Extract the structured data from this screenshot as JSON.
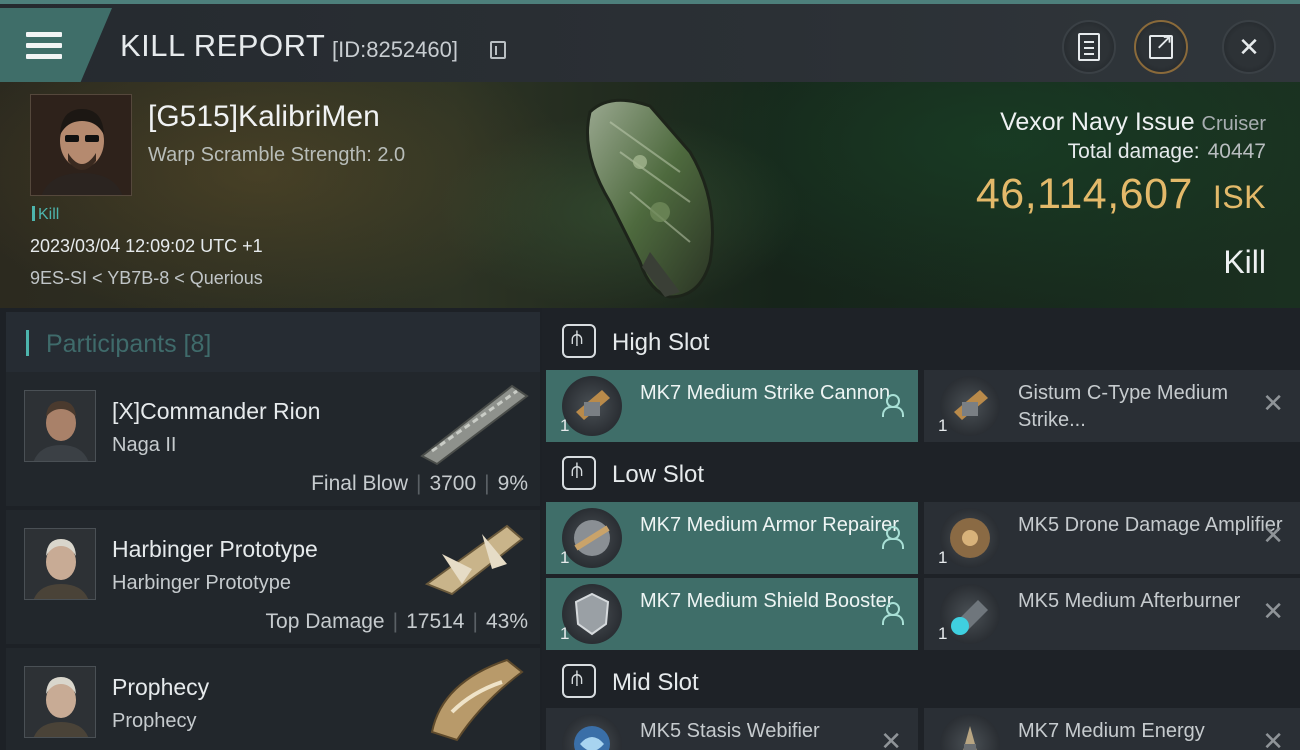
{
  "header": {
    "title": "KILL REPORT",
    "report_id": "[ID:8252460]"
  },
  "victim": {
    "pilot_name": "[G515]KalibriMen",
    "warp_scramble": "Warp Scramble Strength: 2.0",
    "tag": "Kill",
    "timestamp": "2023/03/04 12:09:02 UTC +1",
    "location": "9ES-SI < YB7B-8 < Querious",
    "ship_name": "Vexor Navy Issue",
    "ship_class": "Cruiser",
    "total_damage_label": "Total damage:",
    "total_damage": "40447",
    "isk_value": "46,114,607",
    "isk_unit": "ISK",
    "result": "Kill"
  },
  "participants": {
    "label": "Participants",
    "count": "[8]",
    "list": [
      {
        "name": "[X]Commander Rion",
        "ship": "Naga II",
        "role": "Final Blow",
        "damage": "3700",
        "percent": "9%"
      },
      {
        "name": "Harbinger Prototype",
        "ship": "Harbinger Prototype",
        "role": "Top Damage",
        "damage": "17514",
        "percent": "43%"
      },
      {
        "name": "Prophecy",
        "ship": "Prophecy",
        "role": "",
        "damage": "",
        "percent": ""
      }
    ]
  },
  "slots": {
    "high": {
      "title": "High Slot",
      "modules": [
        {
          "name": "MK7 Medium Strike Cannon",
          "qty": "1",
          "destroyed": false
        },
        {
          "name": "Gistum C-Type Medium Strike...",
          "qty": "1",
          "destroyed": true
        }
      ]
    },
    "low": {
      "title": "Low Slot",
      "modules": [
        {
          "name": "MK7 Medium Armor Repairer",
          "qty": "1",
          "destroyed": false
        },
        {
          "name": "MK5 Drone Damage Amplifier",
          "qty": "1",
          "destroyed": true
        },
        {
          "name": "MK7 Medium Shield Booster",
          "qty": "1",
          "destroyed": false
        },
        {
          "name": "MK5 Medium Afterburner",
          "qty": "1",
          "destroyed": true
        }
      ]
    },
    "mid": {
      "title": "Mid Slot",
      "modules": [
        {
          "name": "MK5 Stasis Webifier",
          "qty": "",
          "destroyed": true
        },
        {
          "name": "MK7 Medium Energy",
          "qty": "",
          "destroyed": true
        }
      ]
    }
  },
  "icons": {
    "menu": "hamburger-icon",
    "copy": "copy-icon",
    "clipboard": "clipboard-icon",
    "share": "share-icon",
    "close": "close-icon",
    "slot": "slot-icon",
    "owner": "person-icon",
    "destroyed": "close-x-icon"
  },
  "colors": {
    "accent": "#4db5ad",
    "active_module": "#3f6e69",
    "isk": "#e3b96a"
  }
}
